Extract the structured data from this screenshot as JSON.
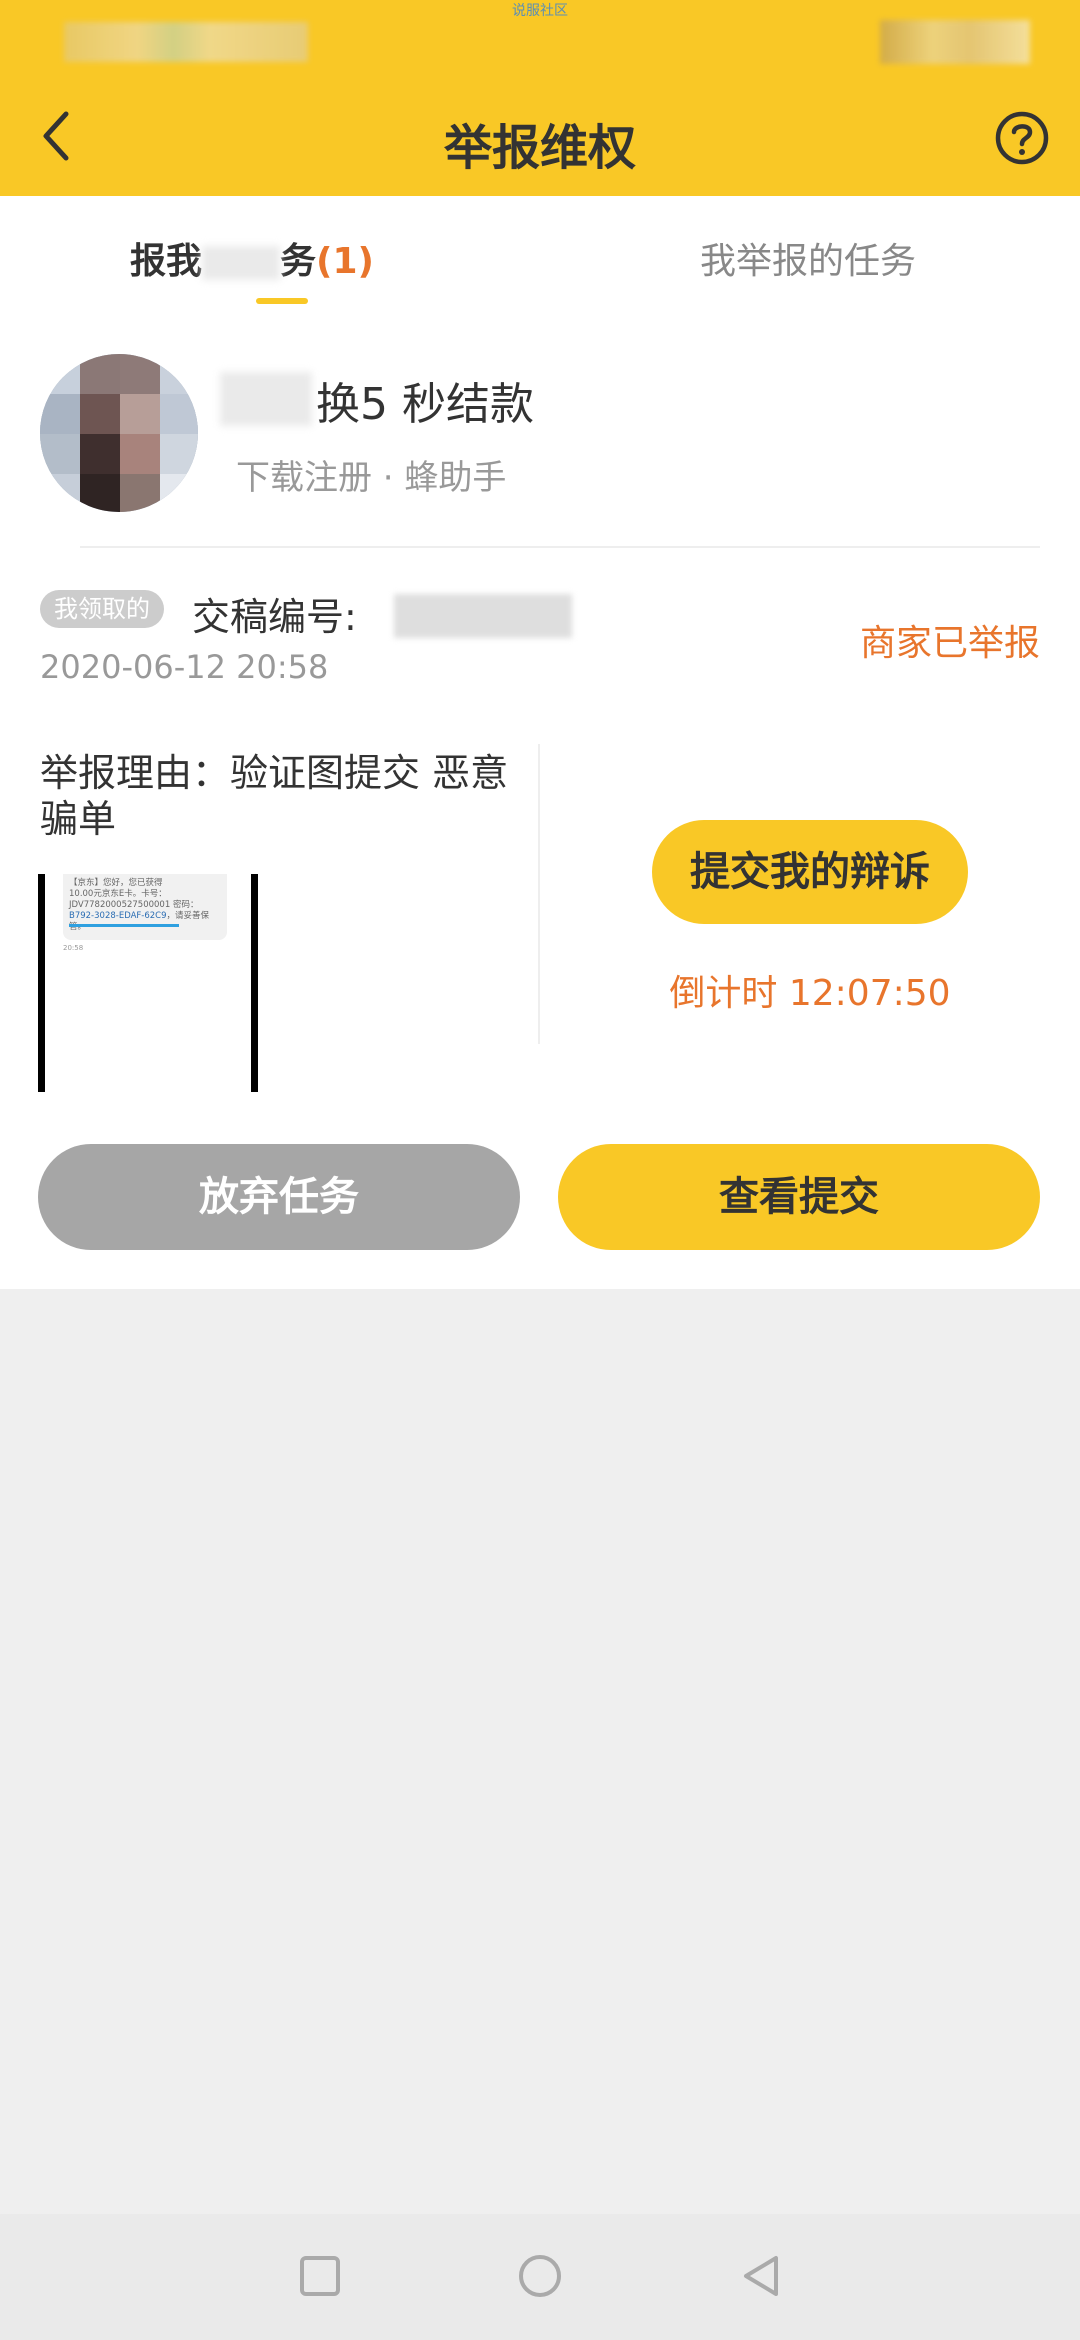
{
  "status_bar": {
    "watermark": "说服社区"
  },
  "header": {
    "title": "举报维权",
    "background_color": "#f9c826",
    "back_icon": "chevron-left-icon",
    "help_icon": "question-circle-icon"
  },
  "tabs": [
    {
      "label": "报我",
      "label_tail": "务",
      "count": "(1)",
      "active": true
    },
    {
      "label": "我举报的任务",
      "active": false
    }
  ],
  "task": {
    "title": "换5   秒结款",
    "subtitle": "下载注册 · 蜂助手",
    "tag": "我领取的",
    "submission_label": "交稿编号:",
    "timestamp": "2020-06-12 20:58",
    "status": "商家已举报",
    "report_reason": "举报理由：验证图提交 恶意骗单",
    "evidence": {
      "message_prefix": "【京东】",
      "message_line1": "您好，您已获得",
      "message_line2": "10.00元京东E卡。卡号：",
      "message_line3": "JDV7782000527500001",
      "message_line4": "密码：",
      "message_code": "B792-3028-EDAF-62C9",
      "message_tail": "，请妥善保管。",
      "meta": "20:58"
    },
    "appeal_button": "提交我的辩诉",
    "countdown": "倒计时 12:07:50"
  },
  "actions": {
    "abandon": "放弃任务",
    "view_submission": "查看提交"
  },
  "accent_colors": {
    "orange": "#e8752c",
    "yellow": "#f9c826",
    "gray_button": "#a6a6a6"
  },
  "nav_bar": {
    "recents_icon": "square-icon",
    "home_icon": "circle-icon",
    "back_icon": "triangle-back-icon"
  }
}
